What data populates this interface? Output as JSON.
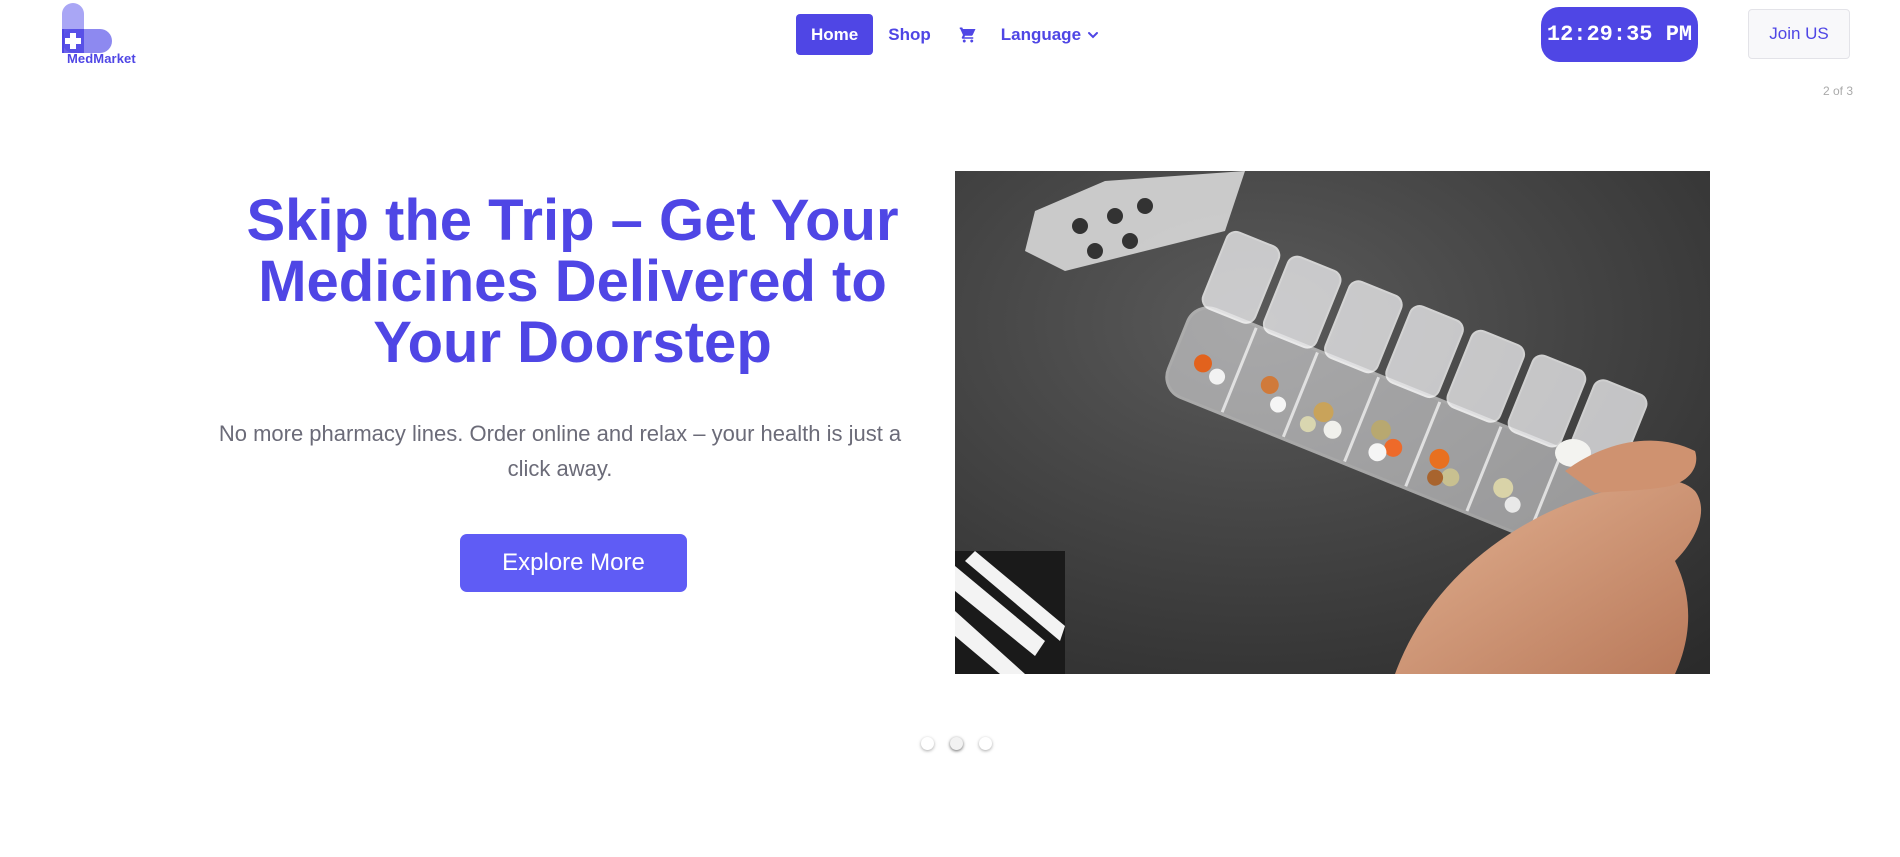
{
  "brand": {
    "name": "MedMarket",
    "logo_icon": "medical-cross-logo",
    "color": "#4f46e5"
  },
  "nav": {
    "home_label": "Home",
    "shop_label": "Shop",
    "cart_icon": "cart-icon",
    "language_label": "Language",
    "language_icon": "chevron-down-icon"
  },
  "clock": {
    "time": "12:29:35 PM"
  },
  "join_label": "Join US",
  "carousel": {
    "counter": "2 of 3",
    "slide_count": 3,
    "active_index": 1
  },
  "hero": {
    "title": "Skip the Trip – Get Your Medicines Delivered to Your Doorstep",
    "subtitle": "No more pharmacy lines. Order online and relax – your health is just a click away.",
    "cta_label": "Explore More"
  },
  "colors": {
    "accent": "#4f46e5",
    "button": "#5f5cf5",
    "subtitle": "#6b6b78"
  }
}
